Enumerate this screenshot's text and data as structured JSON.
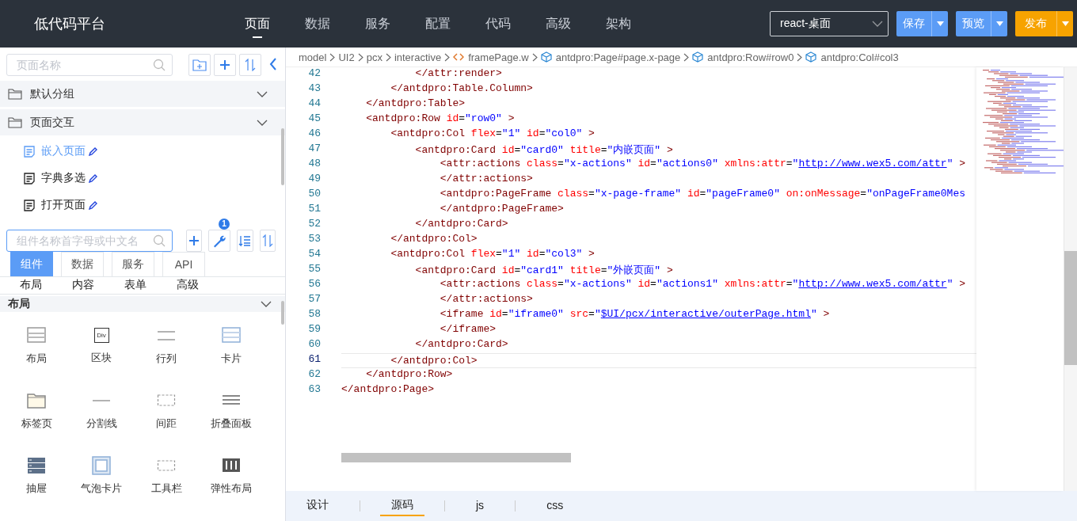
{
  "header": {
    "logo": "低代码平台",
    "nav": [
      {
        "label": "页面",
        "selected": true
      },
      {
        "label": "数据",
        "selected": false
      },
      {
        "label": "服务",
        "selected": false
      },
      {
        "label": "配置",
        "selected": false
      },
      {
        "label": "代码",
        "selected": false
      },
      {
        "label": "高级",
        "selected": false
      },
      {
        "label": "架构",
        "selected": false
      }
    ],
    "env_select": {
      "value": "react-桌面"
    },
    "actions": [
      {
        "label": "保存",
        "color": "#5b9cf6"
      },
      {
        "label": "预览",
        "color": "#5b9cf6"
      },
      {
        "label": "发布",
        "color": "#f7a300"
      }
    ]
  },
  "page_panel": {
    "search": {
      "placeholder": "页面名称"
    },
    "groups": [
      {
        "label": "默认分组"
      },
      {
        "label": "页面交互",
        "children": [
          {
            "label": "嵌入页面",
            "selected": true
          },
          {
            "label": "字典多选",
            "selected": false
          },
          {
            "label": "打开页面",
            "selected": false
          }
        ]
      }
    ]
  },
  "component_panel": {
    "search": {
      "placeholder": "组件名称首字母或中文名"
    },
    "badge": "1",
    "tabs": [
      {
        "label": "组件",
        "selected": true
      },
      {
        "label": "数据",
        "selected": false
      },
      {
        "label": "服务",
        "selected": false
      },
      {
        "label": "API",
        "selected": false
      }
    ],
    "categories": [
      "布局",
      "内容",
      "表单",
      "高级"
    ],
    "section": {
      "title": "布局",
      "items": [
        {
          "label": "布局",
          "kind": "layout"
        },
        {
          "label": "区块",
          "kind": "div",
          "icon_text": "Div"
        },
        {
          "label": "行列",
          "kind": "row"
        },
        {
          "label": "卡片",
          "kind": "card"
        },
        {
          "label": "标签页",
          "kind": "tabs"
        },
        {
          "label": "分割线",
          "kind": "divider"
        },
        {
          "label": "间距",
          "kind": "spacer"
        },
        {
          "label": "折叠面板",
          "kind": "collapse"
        },
        {
          "label": "抽屉",
          "kind": "drawer"
        },
        {
          "label": "气泡卡片",
          "kind": "popover"
        },
        {
          "label": "工具栏",
          "kind": "toolbar"
        },
        {
          "label": "弹性布局",
          "kind": "flex"
        }
      ]
    }
  },
  "editor": {
    "breadcrumb": [
      {
        "label": "model",
        "kind": "folder"
      },
      {
        "label": "UI2",
        "kind": "folder"
      },
      {
        "label": "pcx",
        "kind": "folder"
      },
      {
        "label": "interactive",
        "kind": "folder"
      },
      {
        "label": "framePage.w",
        "kind": "file"
      },
      {
        "label": "antdpro:Page#page.x-page",
        "kind": "component"
      },
      {
        "label": "antdpro:Row#row0",
        "kind": "component"
      },
      {
        "label": "antdpro:Col#col3",
        "kind": "component"
      }
    ],
    "code_lines": [
      {
        "number": "42",
        "selected": false,
        "tokens": [
          {
            "kind": "tag",
            "text": "            </attr:render>"
          }
        ]
      },
      {
        "number": "43",
        "selected": false,
        "tokens": [
          {
            "kind": "tag",
            "text": "        </antdpro:Table.Column>"
          }
        ]
      },
      {
        "number": "44",
        "selected": false,
        "tokens": [
          {
            "kind": "tag",
            "text": "    </antdpro:Table>"
          }
        ]
      },
      {
        "number": "45",
        "selected": false,
        "tokens": [
          {
            "kind": "tag",
            "text": "    <antdpro:Row"
          },
          {
            "kind": "attr",
            "text": " id"
          },
          {
            "kind": "eq",
            "text": "="
          },
          {
            "kind": "value",
            "text": "\"row0\""
          },
          {
            "kind": "tag",
            "text": " >"
          }
        ]
      },
      {
        "number": "46",
        "selected": false,
        "tokens": [
          {
            "kind": "tag",
            "text": "        <antdpro:Col"
          },
          {
            "kind": "attr",
            "text": " flex"
          },
          {
            "kind": "eq",
            "text": "="
          },
          {
            "kind": "value",
            "text": "\"1\""
          },
          {
            "kind": "attr",
            "text": " id"
          },
          {
            "kind": "eq",
            "text": "="
          },
          {
            "kind": "value",
            "text": "\"col0\""
          },
          {
            "kind": "tag",
            "text": " >"
          }
        ]
      },
      {
        "number": "47",
        "selected": false,
        "tokens": [
          {
            "kind": "tag",
            "text": "            <antdpro:Card"
          },
          {
            "kind": "attr",
            "text": " id"
          },
          {
            "kind": "eq",
            "text": "="
          },
          {
            "kind": "value",
            "text": "\"card0\""
          },
          {
            "kind": "attr",
            "text": " title"
          },
          {
            "kind": "eq",
            "text": "="
          },
          {
            "kind": "value",
            "text": "\"内嵌页面\""
          },
          {
            "kind": "tag",
            "text": " >"
          }
        ]
      },
      {
        "number": "48",
        "selected": false,
        "tokens": [
          {
            "kind": "tag",
            "text": "                <attr:actions"
          },
          {
            "kind": "attr",
            "text": " class"
          },
          {
            "kind": "eq",
            "text": "="
          },
          {
            "kind": "value",
            "text": "\"x-actions\""
          },
          {
            "kind": "attr",
            "text": " id"
          },
          {
            "kind": "eq",
            "text": "="
          },
          {
            "kind": "value",
            "text": "\"actions0\""
          },
          {
            "kind": "attr",
            "text": " xmlns:attr"
          },
          {
            "kind": "eq",
            "text": "="
          },
          {
            "kind": "value",
            "text": "\""
          },
          {
            "kind": "link",
            "text": "http://www.wex5.com/attr"
          },
          {
            "kind": "value",
            "text": "\""
          },
          {
            "kind": "tag",
            "text": " >"
          }
        ]
      },
      {
        "number": "49",
        "selected": false,
        "tokens": [
          {
            "kind": "tag",
            "text": "                </attr:actions>"
          }
        ]
      },
      {
        "number": "50",
        "selected": false,
        "tokens": [
          {
            "kind": "tag",
            "text": "                <antdpro:PageFrame"
          },
          {
            "kind": "attr",
            "text": " class"
          },
          {
            "kind": "eq",
            "text": "="
          },
          {
            "kind": "value",
            "text": "\"x-page-frame\""
          },
          {
            "kind": "attr",
            "text": " id"
          },
          {
            "kind": "eq",
            "text": "="
          },
          {
            "kind": "value",
            "text": "\"pageFrame0\""
          },
          {
            "kind": "attr",
            "text": " on:onMessage"
          },
          {
            "kind": "eq",
            "text": "="
          },
          {
            "kind": "value",
            "text": "\"onPageFrame0Mes"
          }
        ]
      },
      {
        "number": "51",
        "selected": false,
        "tokens": [
          {
            "kind": "tag",
            "text": "                </antdpro:PageFrame>"
          }
        ]
      },
      {
        "number": "52",
        "selected": false,
        "tokens": [
          {
            "kind": "tag",
            "text": "            </antdpro:Card>"
          }
        ]
      },
      {
        "number": "53",
        "selected": false,
        "tokens": [
          {
            "kind": "tag",
            "text": "        </antdpro:Col>"
          }
        ]
      },
      {
        "number": "54",
        "selected": false,
        "tokens": [
          {
            "kind": "tag",
            "text": "        <antdpro:Col"
          },
          {
            "kind": "attr",
            "text": " flex"
          },
          {
            "kind": "eq",
            "text": "="
          },
          {
            "kind": "value",
            "text": "\"1\""
          },
          {
            "kind": "attr",
            "text": " id"
          },
          {
            "kind": "eq",
            "text": "="
          },
          {
            "kind": "value",
            "text": "\"col3\""
          },
          {
            "kind": "tag",
            "text": " >"
          }
        ]
      },
      {
        "number": "55",
        "selected": false,
        "tokens": [
          {
            "kind": "tag",
            "text": "            <antdpro:Card"
          },
          {
            "kind": "attr",
            "text": " id"
          },
          {
            "kind": "eq",
            "text": "="
          },
          {
            "kind": "value",
            "text": "\"card1\""
          },
          {
            "kind": "attr",
            "text": " title"
          },
          {
            "kind": "eq",
            "text": "="
          },
          {
            "kind": "value",
            "text": "\"外嵌页面\""
          },
          {
            "kind": "tag",
            "text": " >"
          }
        ]
      },
      {
        "number": "56",
        "selected": false,
        "tokens": [
          {
            "kind": "tag",
            "text": "                <attr:actions"
          },
          {
            "kind": "attr",
            "text": " class"
          },
          {
            "kind": "eq",
            "text": "="
          },
          {
            "kind": "value",
            "text": "\"x-actions\""
          },
          {
            "kind": "attr",
            "text": " id"
          },
          {
            "kind": "eq",
            "text": "="
          },
          {
            "kind": "value",
            "text": "\"actions1\""
          },
          {
            "kind": "attr",
            "text": " xmlns:attr"
          },
          {
            "kind": "eq",
            "text": "="
          },
          {
            "kind": "value",
            "text": "\""
          },
          {
            "kind": "link",
            "text": "http://www.wex5.com/attr"
          },
          {
            "kind": "value",
            "text": "\""
          },
          {
            "kind": "tag",
            "text": " >"
          }
        ]
      },
      {
        "number": "57",
        "selected": false,
        "tokens": [
          {
            "kind": "tag",
            "text": "                </attr:actions>"
          }
        ]
      },
      {
        "number": "58",
        "selected": false,
        "tokens": [
          {
            "kind": "tag",
            "text": "                <iframe"
          },
          {
            "kind": "attr",
            "text": " id"
          },
          {
            "kind": "eq",
            "text": "="
          },
          {
            "kind": "value",
            "text": "\"iframe0\""
          },
          {
            "kind": "attr",
            "text": " src"
          },
          {
            "kind": "eq",
            "text": "="
          },
          {
            "kind": "value",
            "text": "\""
          },
          {
            "kind": "link",
            "text": "$UI/pcx/interactive/outerPage.html"
          },
          {
            "kind": "value",
            "text": "\""
          },
          {
            "kind": "tag",
            "text": " >"
          }
        ]
      },
      {
        "number": "59",
        "selected": false,
        "tokens": [
          {
            "kind": "tag",
            "text": "                </iframe>"
          }
        ]
      },
      {
        "number": "60",
        "selected": false,
        "tokens": [
          {
            "kind": "tag",
            "text": "            </antdpro:Card>"
          }
        ]
      },
      {
        "number": "61",
        "selected": true,
        "tokens": [
          {
            "kind": "tag",
            "text": "        </antdpro:Col>"
          }
        ]
      },
      {
        "number": "62",
        "selected": false,
        "tokens": [
          {
            "kind": "tag",
            "text": "    </antdpro:Row>"
          }
        ]
      },
      {
        "number": "63",
        "selected": false,
        "tokens": [
          {
            "kind": "tag",
            "text": "</antdpro:Page>"
          }
        ]
      }
    ],
    "bottom_tabs": [
      {
        "label": "设计",
        "selected": false
      },
      {
        "label": "源码",
        "selected": true
      },
      {
        "label": "js",
        "selected": false
      },
      {
        "label": "css",
        "selected": false
      }
    ]
  }
}
